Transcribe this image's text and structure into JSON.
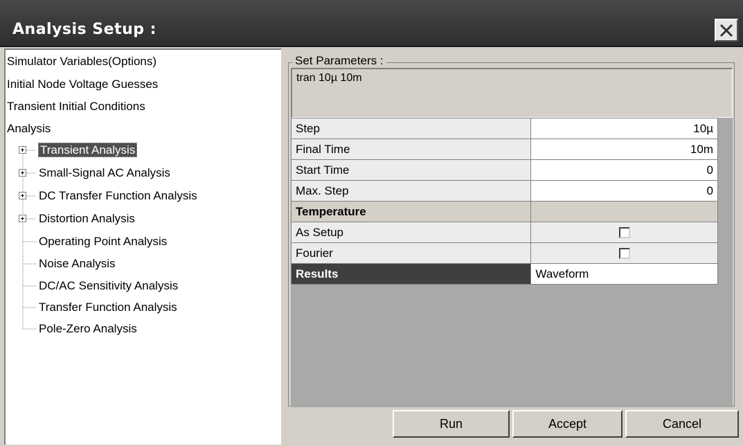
{
  "window": {
    "title": "Analysis Setup  :"
  },
  "tree": {
    "items": [
      {
        "label": "Simulator Variables(Options)"
      },
      {
        "label": "Initial Node Voltage Guesses"
      },
      {
        "label": "Transient Initial Conditions"
      },
      {
        "label": "Analysis"
      },
      {
        "label": "Transient Analysis"
      },
      {
        "label": "Small-Signal AC Analysis"
      },
      {
        "label": "DC Transfer Function Analysis"
      },
      {
        "label": "Distortion Analysis"
      },
      {
        "label": "Operating Point Analysis"
      },
      {
        "label": "Noise Analysis"
      },
      {
        "label": "DC/AC Sensitivity Analysis"
      },
      {
        "label": "Transfer Function Analysis"
      },
      {
        "label": "Pole-Zero Analysis"
      }
    ]
  },
  "params": {
    "group_label": "Set Parameters  :",
    "text": "tran 10µ 10m",
    "rows": [
      {
        "label": "Step",
        "value": "10µ"
      },
      {
        "label": "Final Time",
        "value": "10m"
      },
      {
        "label": "Start Time",
        "value": "0"
      },
      {
        "label": "Max. Step",
        "value": "0"
      },
      {
        "label": "Temperature",
        "value": ""
      },
      {
        "label": "As Setup",
        "value": ""
      },
      {
        "label": "Fourier",
        "value": ""
      },
      {
        "label": "Results",
        "value": "Waveform"
      }
    ]
  },
  "buttons": {
    "run": "Run",
    "accept": "Accept",
    "cancel": "Cancel"
  },
  "icons": {
    "close": "close-icon",
    "expand": "plus-box-icon"
  }
}
